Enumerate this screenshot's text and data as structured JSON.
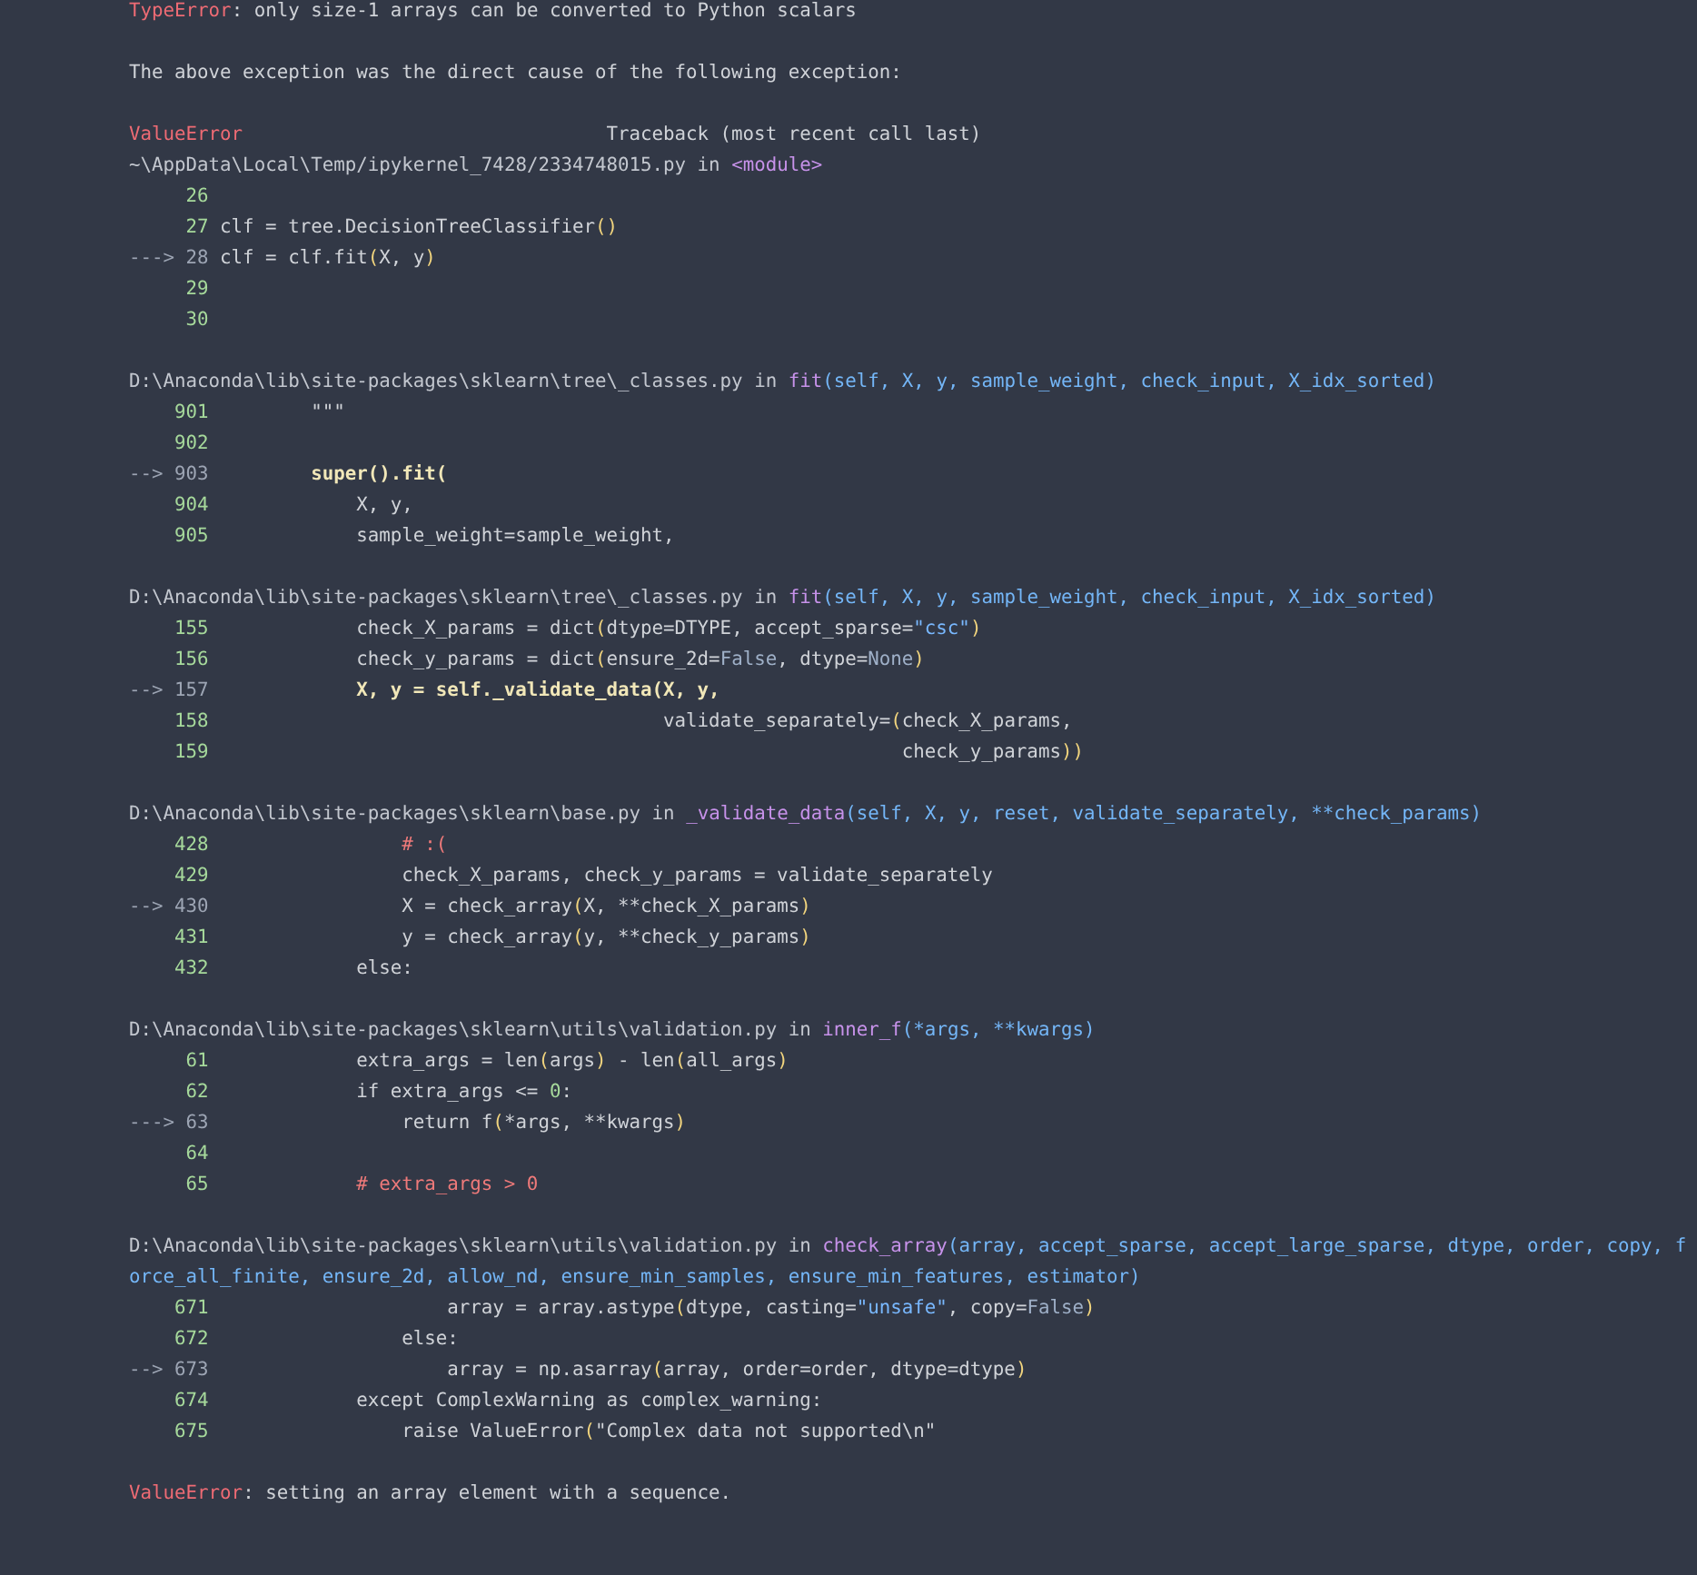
{
  "previous_error": {
    "type": "TypeError",
    "message": ": only size-1 arrays can be converted to Python scalars"
  },
  "cause_note": "The above exception was the direct cause of the following exception:",
  "traceback_header": {
    "error": "ValueError",
    "label": "Traceback (most recent call last)"
  },
  "frames": [
    {
      "path": "~\\AppData\\Local\\Temp/ipykernel_7428/2334748015.py",
      "in": "in",
      "function": "<module>",
      "lines": [
        {
          "number": "26",
          "current": false
        },
        {
          "number": "27",
          "current": false,
          "code": [
            {
              "text": "clf = tree.DecisionTreeClassifier",
              "kind": "plain"
            },
            {
              "text": "()",
              "kind": "paren"
            }
          ]
        },
        {
          "number": "28",
          "current": true,
          "marker": "--->",
          "code": [
            {
              "text": "clf = clf.fit",
              "kind": "plain"
            },
            {
              "text": "(",
              "kind": "paren"
            },
            {
              "text": "X, y",
              "kind": "plain"
            },
            {
              "text": ")",
              "kind": "paren"
            }
          ]
        },
        {
          "number": "29",
          "current": false
        },
        {
          "number": "30",
          "current": false
        }
      ]
    },
    {
      "path": "D:\\Anaconda\\lib\\site-packages\\sklearn\\tree\\_classes.py",
      "in": "in",
      "function": "fit",
      "args": "(self, X, y, sample_weight, check_input, X_idx_sorted)",
      "lines": [
        {
          "number": "901",
          "current": false,
          "code": [
            {
              "text": "        \"\"\"",
              "kind": "plain"
            }
          ]
        },
        {
          "number": "902",
          "current": false
        },
        {
          "number": "903",
          "current": true,
          "marker": "-->",
          "code": [
            {
              "text": "        super().fit(",
              "kind": "bold"
            }
          ]
        },
        {
          "number": "904",
          "current": false,
          "code": [
            {
              "text": "            X, y,",
              "kind": "plain"
            }
          ]
        },
        {
          "number": "905",
          "current": false,
          "code": [
            {
              "text": "            sample_weight=sample_weight,",
              "kind": "plain"
            }
          ]
        }
      ]
    },
    {
      "path": "D:\\Anaconda\\lib\\site-packages\\sklearn\\tree\\_classes.py",
      "in": "in",
      "function": "fit",
      "args": "(self, X, y, sample_weight, check_input, X_idx_sorted)",
      "lines": [
        {
          "number": "155",
          "current": false,
          "code": [
            {
              "text": "            check_X_params = dict",
              "kind": "plain"
            },
            {
              "text": "(",
              "kind": "paren"
            },
            {
              "text": "dtype=DTYPE, accept_sparse=",
              "kind": "plain"
            },
            {
              "text": "\"csc\"",
              "kind": "string"
            },
            {
              "text": ")",
              "kind": "paren"
            }
          ]
        },
        {
          "number": "156",
          "current": false,
          "code": [
            {
              "text": "            check_y_params = dict",
              "kind": "plain"
            },
            {
              "text": "(",
              "kind": "paren"
            },
            {
              "text": "ensure_2d=",
              "kind": "plain"
            },
            {
              "text": "False",
              "kind": "const"
            },
            {
              "text": ", dtype=",
              "kind": "plain"
            },
            {
              "text": "None",
              "kind": "const"
            },
            {
              "text": ")",
              "kind": "paren"
            }
          ]
        },
        {
          "number": "157",
          "current": true,
          "marker": "-->",
          "code": [
            {
              "text": "            X, y = self._validate_data(X, y,",
              "kind": "bold"
            }
          ]
        },
        {
          "number": "158",
          "current": false,
          "code": [
            {
              "text": "                                       validate_separately=",
              "kind": "plain"
            },
            {
              "text": "(",
              "kind": "paren"
            },
            {
              "text": "check_X_params,",
              "kind": "plain"
            }
          ]
        },
        {
          "number": "159",
          "current": false,
          "code": [
            {
              "text": "                                                            check_y_params",
              "kind": "plain"
            },
            {
              "text": "))",
              "kind": "paren"
            }
          ]
        }
      ]
    },
    {
      "path": "D:\\Anaconda\\lib\\site-packages\\sklearn\\base.py",
      "in": "in",
      "function": "_validate_data",
      "args": "(self, X, y, reset, validate_separately, **check_params)",
      "lines": [
        {
          "number": "428",
          "current": false,
          "code": [
            {
              "text": "                # :(",
              "kind": "comment"
            }
          ]
        },
        {
          "number": "429",
          "current": false,
          "code": [
            {
              "text": "                check_X_params, check_y_params = validate_separately",
              "kind": "plain"
            }
          ]
        },
        {
          "number": "430",
          "current": true,
          "marker": "-->",
          "code": [
            {
              "text": "                X = check_array",
              "kind": "plain"
            },
            {
              "text": "(",
              "kind": "paren"
            },
            {
              "text": "X, **check_X_params",
              "kind": "plain"
            },
            {
              "text": ")",
              "kind": "paren"
            }
          ]
        },
        {
          "number": "431",
          "current": false,
          "code": [
            {
              "text": "                y = check_array",
              "kind": "plain"
            },
            {
              "text": "(",
              "kind": "paren"
            },
            {
              "text": "y, **check_y_params",
              "kind": "plain"
            },
            {
              "text": ")",
              "kind": "paren"
            }
          ]
        },
        {
          "number": "432",
          "current": false,
          "code": [
            {
              "text": "            else:",
              "kind": "plain"
            }
          ]
        }
      ]
    },
    {
      "path": "D:\\Anaconda\\lib\\site-packages\\sklearn\\utils\\validation.py",
      "in": "in",
      "function": "inner_f",
      "args": "(*args, **kwargs)",
      "lines": [
        {
          "number": "61",
          "current": false,
          "code": [
            {
              "text": "            extra_args = len",
              "kind": "plain"
            },
            {
              "text": "(",
              "kind": "paren"
            },
            {
              "text": "args",
              "kind": "plain"
            },
            {
              "text": ")",
              "kind": "paren"
            },
            {
              "text": " - len",
              "kind": "plain"
            },
            {
              "text": "(",
              "kind": "paren"
            },
            {
              "text": "all_args",
              "kind": "plain"
            },
            {
              "text": ")",
              "kind": "paren"
            }
          ]
        },
        {
          "number": "62",
          "current": false,
          "code": [
            {
              "text": "            if extra_args <= ",
              "kind": "plain"
            },
            {
              "text": "0",
              "kind": "number"
            },
            {
              "text": ":",
              "kind": "plain"
            }
          ]
        },
        {
          "number": "63",
          "current": true,
          "marker": "--->",
          "code": [
            {
              "text": "                return f",
              "kind": "plain"
            },
            {
              "text": "(",
              "kind": "paren"
            },
            {
              "text": "*args, **kwargs",
              "kind": "plain"
            },
            {
              "text": ")",
              "kind": "paren"
            }
          ]
        },
        {
          "number": "64",
          "current": false
        },
        {
          "number": "65",
          "current": false,
          "code": [
            {
              "text": "            # extra_args > 0",
              "kind": "comment"
            }
          ]
        }
      ]
    },
    {
      "path": "D:\\Anaconda\\lib\\site-packages\\sklearn\\utils\\validation.py",
      "in": "in",
      "function": "check_array",
      "args": "(array, accept_sparse, accept_large_sparse, dtype, order, copy, force_all_finite, ensure_2d, allow_nd, ensure_min_samples, ensure_min_features, estimator)",
      "lines": [
        {
          "number": "671",
          "current": false,
          "code": [
            {
              "text": "                    array = array.astype",
              "kind": "plain"
            },
            {
              "text": "(",
              "kind": "paren"
            },
            {
              "text": "dtype, casting=",
              "kind": "plain"
            },
            {
              "text": "\"unsafe\"",
              "kind": "string"
            },
            {
              "text": ", copy=",
              "kind": "plain"
            },
            {
              "text": "False",
              "kind": "const"
            },
            {
              "text": ")",
              "kind": "paren"
            }
          ]
        },
        {
          "number": "672",
          "current": false,
          "code": [
            {
              "text": "                else:",
              "kind": "plain"
            }
          ]
        },
        {
          "number": "673",
          "current": true,
          "marker": "-->",
          "code": [
            {
              "text": "                    array = np.asarray",
              "kind": "plain"
            },
            {
              "text": "(",
              "kind": "paren"
            },
            {
              "text": "array, order=order, dtype=dtype",
              "kind": "plain"
            },
            {
              "text": ")",
              "kind": "paren"
            }
          ]
        },
        {
          "number": "674",
          "current": false,
          "code": [
            {
              "text": "            except ComplexWarning as complex_warning:",
              "kind": "plain"
            }
          ]
        },
        {
          "number": "675",
          "current": false,
          "code": [
            {
              "text": "                raise ValueError",
              "kind": "plain"
            },
            {
              "text": "(",
              "kind": "paren"
            },
            {
              "text": "\"Complex data not supported\\n\"",
              "kind": "plain"
            }
          ]
        }
      ]
    }
  ],
  "final_error": {
    "type": "ValueError",
    "message": ": setting an array element with a sequence."
  }
}
